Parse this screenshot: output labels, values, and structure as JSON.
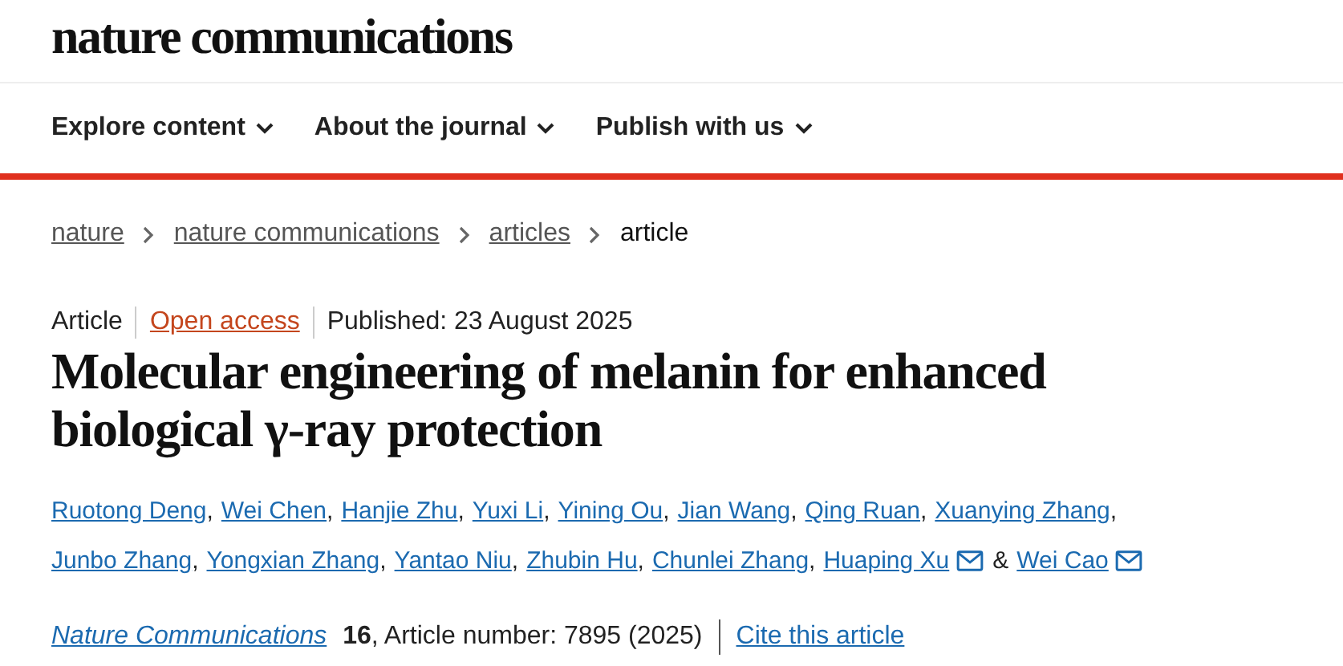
{
  "header": {
    "logo": "nature communications"
  },
  "nav": [
    {
      "label": "Explore content",
      "expanded": false
    },
    {
      "label": "About the journal",
      "expanded": false
    },
    {
      "label": "Publish with us",
      "expanded": false
    }
  ],
  "breadcrumbs": [
    {
      "label": "nature",
      "current": false
    },
    {
      "label": "nature communications",
      "current": false
    },
    {
      "label": "articles",
      "current": false
    },
    {
      "label": "article",
      "current": true
    }
  ],
  "article": {
    "type": "Article",
    "access": "Open access",
    "published": "Published: 23 August 2025",
    "title": "Molecular engineering of melanin for enhanced biological γ-ray protection",
    "authors": [
      {
        "name": "Ruotong Deng",
        "email": false,
        "separator": ","
      },
      {
        "name": "Wei Chen",
        "email": false,
        "separator": ","
      },
      {
        "name": "Hanjie Zhu",
        "email": false,
        "separator": ","
      },
      {
        "name": "Yuxi Li",
        "email": false,
        "separator": ","
      },
      {
        "name": "Yining Ou",
        "email": false,
        "separator": ","
      },
      {
        "name": "Jian Wang",
        "email": false,
        "separator": ","
      },
      {
        "name": "Qing Ruan",
        "email": false,
        "separator": ","
      },
      {
        "name": "Xuanying Zhang",
        "email": false,
        "separator": ","
      },
      {
        "name": "Junbo Zhang",
        "email": false,
        "separator": ","
      },
      {
        "name": "Yongxian Zhang",
        "email": false,
        "separator": ","
      },
      {
        "name": "Yantao Niu",
        "email": false,
        "separator": ","
      },
      {
        "name": "Zhubin Hu",
        "email": false,
        "separator": ","
      },
      {
        "name": "Chunlei Zhang",
        "email": false,
        "separator": ","
      },
      {
        "name": "Huaping Xu",
        "email": true,
        "separator": "&"
      },
      {
        "name": "Wei Cao",
        "email": true
      }
    ],
    "journal": "Nature Communications",
    "volume": "16",
    "number": ", Article number: 7895 (2025)",
    "cite": "Cite this article"
  }
}
